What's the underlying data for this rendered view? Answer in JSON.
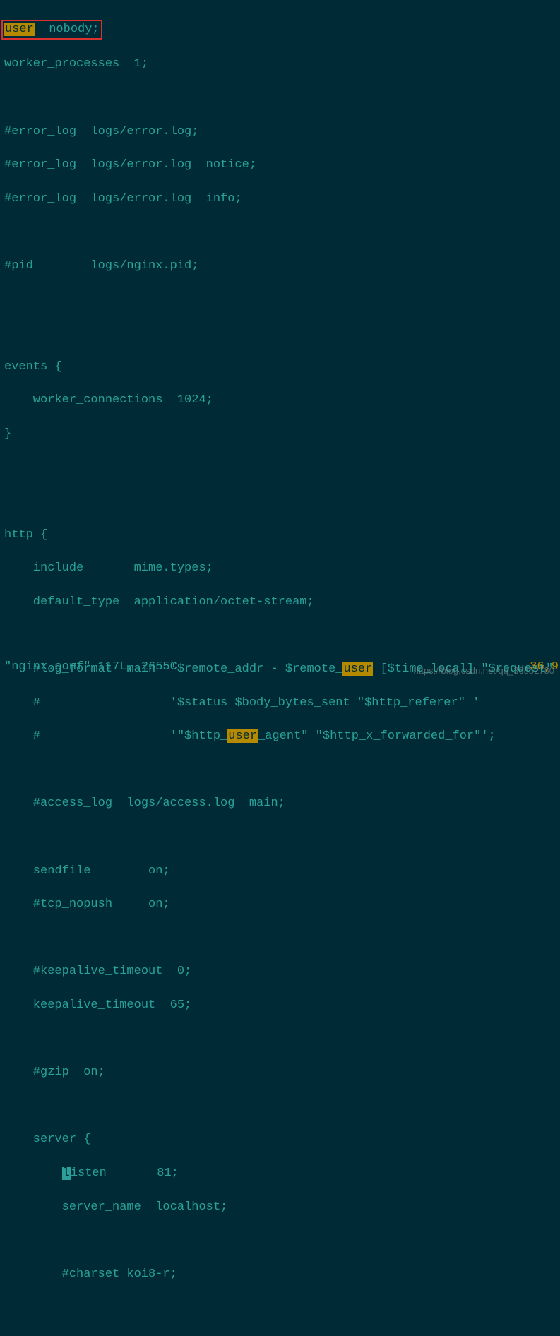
{
  "highlighted_word": "user",
  "code": {
    "l1_pre": "",
    "l1_hl": "user",
    "l1_post": "  nobody;",
    "l2": "worker_processes  1;",
    "l3": "",
    "l4": "#error_log  logs/error.log;",
    "l5": "#error_log  logs/error.log  notice;",
    "l6": "#error_log  logs/error.log  info;",
    "l7": "",
    "l8": "#pid        logs/nginx.pid;",
    "l9": "",
    "l10": "",
    "l11": "events {",
    "l12": "    worker_connections  1024;",
    "l13": "}",
    "l14": "",
    "l15": "",
    "l16": "http {",
    "l17": "    include       mime.types;",
    "l18": "    default_type  application/octet-stream;",
    "l19": "",
    "l20_pre": "    #log_format  main  '$remote_addr - $remote_",
    "l20_hl": "user",
    "l20_post": " [$time_local] \"$request\" '",
    "l21": "    #                  '$status $body_bytes_sent \"$http_referer\" '",
    "l22_pre": "    #                  '\"$http_",
    "l22_hl": "user",
    "l22_post": "_agent\" \"$http_x_forwarded_for\"';",
    "l23": "",
    "l24": "    #access_log  logs/access.log  main;",
    "l25": "",
    "l26": "    sendfile        on;",
    "l27": "    #tcp_nopush     on;",
    "l28": "",
    "l29": "    #keepalive_timeout  0;",
    "l30": "    keepalive_timeout  65;",
    "l31": "",
    "l32": "    #gzip  on;",
    "l33": "",
    "l34": "    server {",
    "l35_pre": "        ",
    "l35_cursor": "l",
    "l35_post": "isten       81;",
    "l36": "        server_name  localhost;",
    "l37": "",
    "l38": "        #charset koi8-r;",
    "l39": ""
  },
  "status": {
    "left": "\"nginx.conf\" 117L, 2655C",
    "right": "36,9"
  },
  "watermark": "https://blog.csdn.net/qq_36852780"
}
